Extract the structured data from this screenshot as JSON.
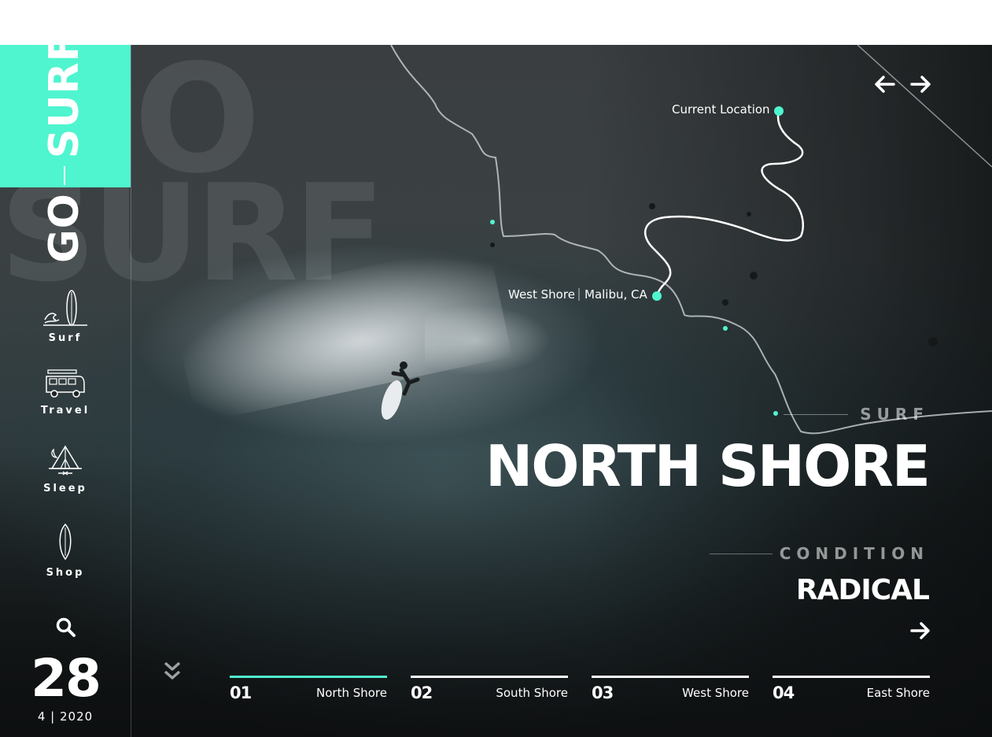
{
  "brand": {
    "go": "GO",
    "surf": "SURF"
  },
  "watermark": {
    "line1": "O",
    "line2": "SURF"
  },
  "sidebar": {
    "items": [
      {
        "label": "Surf",
        "icon": "surfboard-wave-icon"
      },
      {
        "label": "Travel",
        "icon": "van-icon"
      },
      {
        "label": "Sleep",
        "icon": "tent-icon"
      },
      {
        "label": "Shop",
        "icon": "surfboard-icon"
      }
    ],
    "search_icon": "search-icon"
  },
  "date": {
    "day": "28",
    "month_year": "4 | 2020"
  },
  "map": {
    "current_location": "Current Location",
    "spot_name": "West Shore",
    "spot_place": "Malibu, CA",
    "accent": "#4ff5cf"
  },
  "hero": {
    "kicker": "SURF",
    "title": "NORTH SHORE",
    "condition_label": "CONDITION",
    "condition_value": "RADICAL"
  },
  "tabs": [
    {
      "num": "01",
      "name": "North Shore",
      "active": true
    },
    {
      "num": "02",
      "name": "South Shore",
      "active": false
    },
    {
      "num": "03",
      "name": "West Shore",
      "active": false
    },
    {
      "num": "04",
      "name": "East Shore",
      "active": false
    }
  ],
  "colors": {
    "accent": "#4ff5cf",
    "text": "#ffffff"
  }
}
